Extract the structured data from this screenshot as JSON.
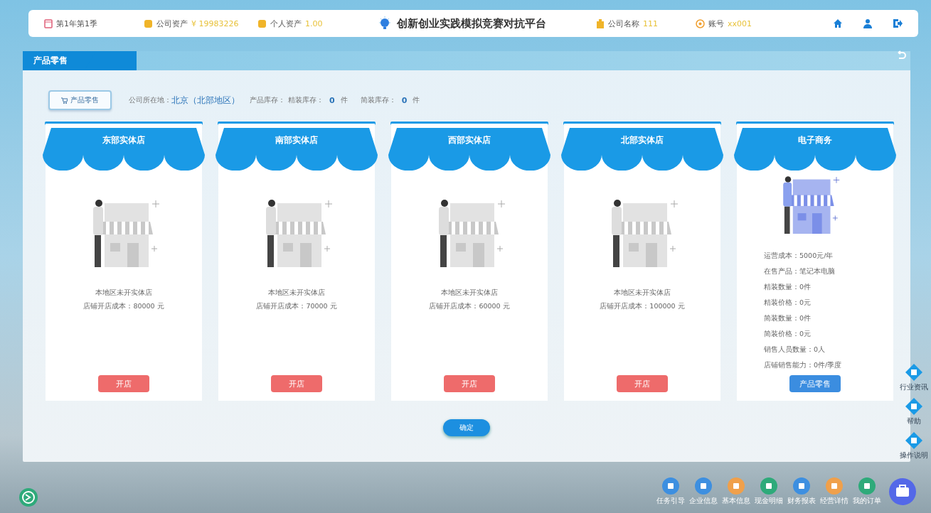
{
  "top_bar": {
    "period": "第1年第1季",
    "company_assets_label": "公司资产",
    "company_assets": "¥ 19983226",
    "personal_assets_label": "个人资产",
    "personal_assets": "1.00",
    "title": "创新创业实践模拟竞赛对抗平台",
    "company_name_label": "公司名称",
    "company_name": "111",
    "account_label": "账号",
    "account": "xx001"
  },
  "panel": {
    "title": "产品零售",
    "tab_button": "产品零售",
    "location_label": "公司所在地：",
    "location": "北京（北部地区）",
    "stock_label": "产品库存：",
    "stocks": [
      {
        "label": "精装库存：",
        "value": "0",
        "unit": "件"
      },
      {
        "label": "简装库存：",
        "value": "0",
        "unit": "件"
      }
    ],
    "stores": [
      {
        "name": "东部实体店",
        "opened": false,
        "lines": [
          "本地区未开实体店",
          "店铺开店成本：80000 元"
        ],
        "button": "开店"
      },
      {
        "name": "南部实体店",
        "opened": false,
        "lines": [
          "本地区未开实体店",
          "店铺开店成本：70000 元"
        ],
        "button": "开店"
      },
      {
        "name": "西部实体店",
        "opened": false,
        "lines": [
          "本地区未开实体店",
          "店铺开店成本：60000 元"
        ],
        "button": "开店"
      },
      {
        "name": "北部实体店",
        "opened": false,
        "lines": [
          "本地区未开实体店",
          "店铺开店成本：100000 元"
        ],
        "button": "开店"
      },
      {
        "name": "电子商务",
        "opened": true,
        "lines": [
          "运营成本：5000元/年",
          "在售产品：笔记本电脑",
          "精装数量：0件",
          "精装价格：0元",
          "简装数量：0件",
          "简装价格：0元",
          "销售人员数量：0人",
          "店铺销售能力：0件/季度"
        ],
        "button": "产品零售"
      }
    ],
    "confirm_button": "确定"
  },
  "side_tools": [
    "行业资讯",
    "帮助",
    "操作说明"
  ],
  "dock": [
    {
      "label": "任务引导",
      "color": "#3d8fe0"
    },
    {
      "label": "企业信息",
      "color": "#3d8fe0"
    },
    {
      "label": "基本信息",
      "color": "#f0a04b"
    },
    {
      "label": "现金明细",
      "color": "#2eaa7a"
    },
    {
      "label": "财务报表",
      "color": "#3d8fe0"
    },
    {
      "label": "经营详情",
      "color": "#f0a04b"
    },
    {
      "label": "我的订单",
      "color": "#2eaa7a"
    }
  ]
}
